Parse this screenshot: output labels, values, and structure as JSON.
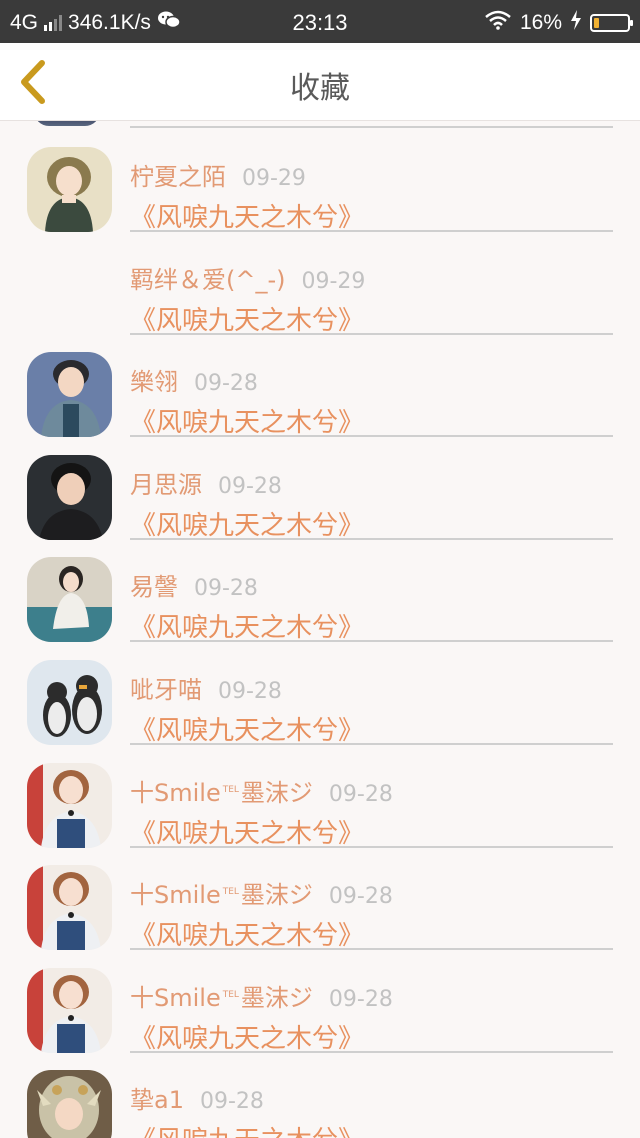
{
  "status_bar": {
    "network": "4G",
    "speed": "346.1K/s",
    "time": "23:13",
    "battery": "16%",
    "battery_level": 0.16,
    "accent": "#f2b233"
  },
  "header": {
    "title": "收藏",
    "back_icon": "chevron-left-icon",
    "back_color": "#c99a1e"
  },
  "items": [
    {
      "name": "柠夏之陌",
      "tel": "",
      "name_suffix": "",
      "date": "09-29",
      "title": "《风唳九天之木兮》",
      "avatar": "girl-green-dress"
    },
    {
      "name": "羁绊＆爱(^_-)",
      "tel": "",
      "name_suffix": "",
      "date": "09-29",
      "title": "《风唳九天之木兮》",
      "avatar": ""
    },
    {
      "name": "樂翎",
      "tel": "",
      "name_suffix": "",
      "date": "09-28",
      "title": "《风唳九天之木兮》",
      "avatar": "boy-denim"
    },
    {
      "name": "月思源",
      "tel": "",
      "name_suffix": "",
      "date": "09-28",
      "title": "《风唳九天之木兮》",
      "avatar": "boy-dark"
    },
    {
      "name": "易謦",
      "tel": "",
      "name_suffix": "",
      "date": "09-28",
      "title": "《风唳九天之木兮》",
      "avatar": "girl-sitting"
    },
    {
      "name": "呲牙喵",
      "tel": "",
      "name_suffix": "",
      "date": "09-28",
      "title": "《风唳九天之木兮》",
      "avatar": "penguins"
    },
    {
      "name": "十Smile",
      "tel": "TEL",
      "name_suffix": "墨沫ジ",
      "date": "09-28",
      "title": "《风唳九天之木兮》",
      "avatar": "girl-overalls"
    },
    {
      "name": "十Smile",
      "tel": "TEL",
      "name_suffix": "墨沫ジ",
      "date": "09-28",
      "title": "《风唳九天之木兮》",
      "avatar": "girl-overalls"
    },
    {
      "name": "十Smile",
      "tel": "TEL",
      "name_suffix": "墨沫ジ",
      "date": "09-28",
      "title": "《风唳九天之木兮》",
      "avatar": "girl-overalls"
    },
    {
      "name": "挚a1",
      "tel": "",
      "name_suffix": "",
      "date": "09-28",
      "title": "《风唳九天之木兮》",
      "avatar": "elf-girl"
    }
  ]
}
